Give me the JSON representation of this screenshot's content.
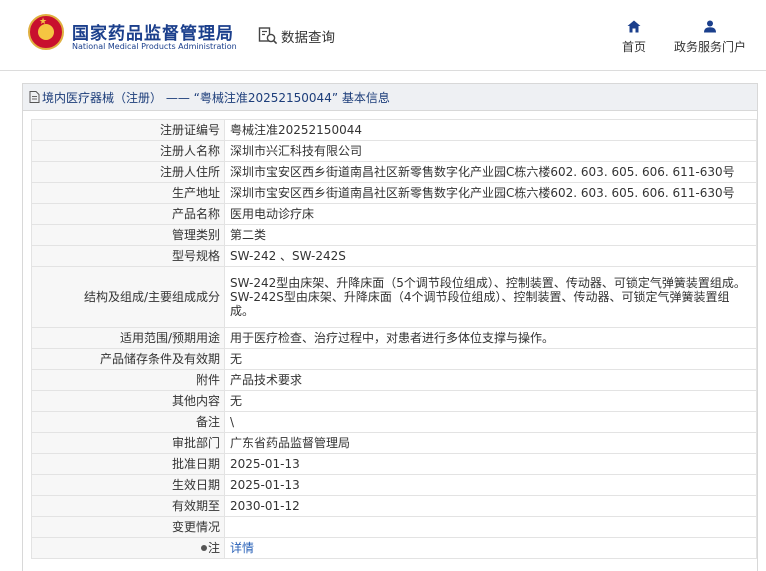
{
  "header": {
    "brand_cn": "国家药品监督管理局",
    "brand_en": "National Medical Products Administration",
    "search_label": "数据查询",
    "nav": {
      "home_label": "首页",
      "portal_label": "政务服务门户"
    }
  },
  "panel": {
    "title": "境内医疗器械（注册） —— “粤械注准20252150044” 基本信息"
  },
  "details": {
    "rows": [
      {
        "label": "注册证编号",
        "value": "粤械注准20252150044"
      },
      {
        "label": "注册人名称",
        "value": "深圳市兴汇科技有限公司"
      },
      {
        "label": "注册人住所",
        "value": "深圳市宝安区西乡街道南昌社区新零售数字化产业园C栋六楼602. 603. 605. 606. 611-630号"
      },
      {
        "label": "生产地址",
        "value": "深圳市宝安区西乡街道南昌社区新零售数字化产业园C栋六楼602. 603. 605. 606. 611-630号"
      },
      {
        "label": "产品名称",
        "value": "医用电动诊疗床"
      },
      {
        "label": "管理类别",
        "value": "第二类"
      },
      {
        "label": "型号规格",
        "value": "SW-242 、SW-242S"
      },
      {
        "label": "结构及组成/主要组成成分",
        "value_lines": [
          "SW-242型由床架、升降床面（5个调节段位组成）、控制装置、传动器、可锁定气弹簧装置组成。",
          "SW-242S型由床架、升降床面（4个调节段位组成）、控制装置、传动器、可锁定气弹簧装置组成。"
        ]
      },
      {
        "label": "适用范围/预期用途",
        "value": "用于医疗检查、治疗过程中，对患者进行多体位支撑与操作。"
      },
      {
        "label": "产品储存条件及有效期",
        "value": "无"
      },
      {
        "label": "附件",
        "value": "产品技术要求"
      },
      {
        "label": "其他内容",
        "value": "无"
      },
      {
        "label": "备注",
        "value": "\\"
      },
      {
        "label": "审批部门",
        "value": "广东省药品监督管理局"
      },
      {
        "label": "批准日期",
        "value": "2025-01-13"
      },
      {
        "label": "生效日期",
        "value": "2025-01-13"
      },
      {
        "label": "有效期至",
        "value": "2030-01-12"
      },
      {
        "label": "变更情况",
        "value": ""
      },
      {
        "label": "注",
        "value": "详情"
      }
    ]
  },
  "icons": {
    "logo": "national-emblem-icon",
    "search": "search-document-icon",
    "home": "home-icon",
    "portal": "user-icon",
    "panel": "document-icon",
    "note": "pin-icon"
  },
  "colors": {
    "brand_blue": "#1b3f8c",
    "link_blue": "#2a62b8",
    "emblem_red": "#c8102e",
    "emblem_gold": "#f5c542"
  }
}
